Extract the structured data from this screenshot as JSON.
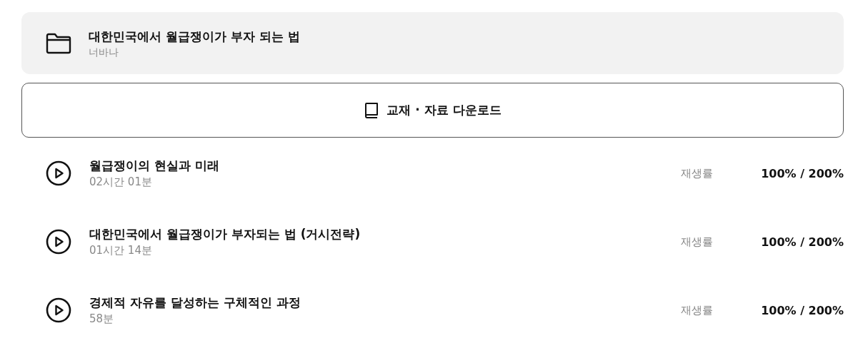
{
  "course": {
    "title": "대한민국에서 월급쟁이가 부자 되는 법",
    "author": "너바나"
  },
  "download_button": {
    "label": "교재 · 자료 다운로드"
  },
  "lectures": [
    {
      "title": "월급쟁이의 현실과 미래",
      "duration": "02시간 01분",
      "rate_label": "재생률",
      "rate_value": "100% / 200%"
    },
    {
      "title": "대한민국에서 월급쟁이가 부자되는 법 (거시전략)",
      "duration": "01시간 14분",
      "rate_label": "재생률",
      "rate_value": "100% / 200%"
    },
    {
      "title": "경제적 자유를 달성하는 구체적인 과정",
      "duration": "58분",
      "rate_label": "재생률",
      "rate_value": "100% / 200%"
    }
  ]
}
